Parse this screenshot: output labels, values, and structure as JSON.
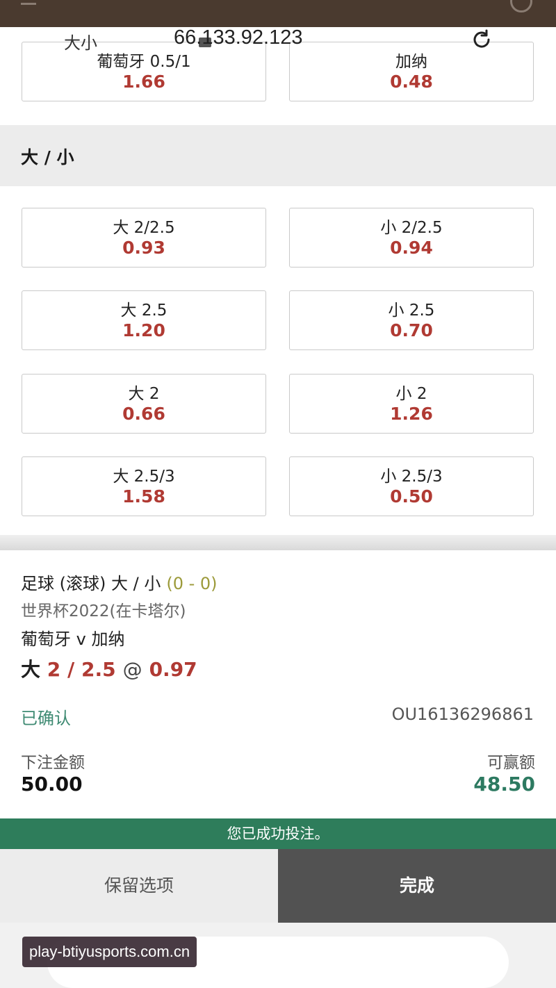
{
  "handicap_row": [
    {
      "label": "葡萄牙 0.5/1",
      "price": "1.66"
    },
    {
      "label": "加纳",
      "price": "0.48"
    }
  ],
  "market": {
    "title": "大 / 小"
  },
  "ou_rows": [
    [
      {
        "label": "大 2/2.5",
        "price": "0.93"
      },
      {
        "label": "小 2/2.5",
        "price": "0.94"
      }
    ],
    [
      {
        "label": "大 2.5",
        "price": "1.20"
      },
      {
        "label": "小 2.5",
        "price": "0.70"
      }
    ],
    [
      {
        "label": "大 2",
        "price": "0.66"
      },
      {
        "label": "小 2",
        "price": "1.26"
      }
    ],
    [
      {
        "label": "大 2.5/3",
        "price": "1.58"
      },
      {
        "label": "小 2.5/3",
        "price": "0.50"
      }
    ]
  ],
  "slip": {
    "sport": "足球 (滚球) 大 / 小",
    "score": "(0 - 0)",
    "competition": "世界杯2022(在卡塔尔)",
    "match": "葡萄牙 v 加纳",
    "pick_side": "大",
    "pick_line": "2 / 2.5",
    "pick_at": "@",
    "pick_odds": "0.97",
    "status": "已确认",
    "reference": "OU16136296861",
    "stake_label": "下注金额",
    "stake": "50.00",
    "win_label": "可赢额",
    "win": "48.50"
  },
  "success_message": "您已成功投注。",
  "actions": {
    "keep": "保留选项",
    "done": "完成"
  },
  "browser": {
    "url": "66.133.92.123",
    "partial_text": "大小"
  },
  "watermark": "play-btiyusports.com.cn",
  "colors": {
    "price_red": "#b03a33",
    "success_green": "#2e7d5b",
    "win_green": "#2d7a61"
  }
}
